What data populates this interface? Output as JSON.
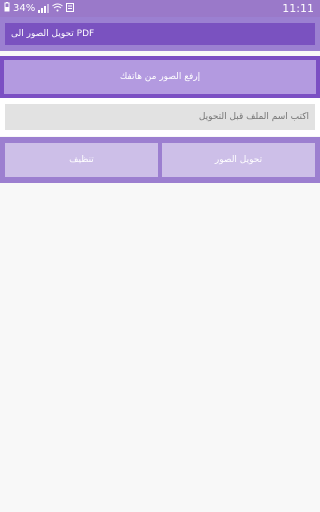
{
  "status_bar": {
    "battery": "34%",
    "time": "11:11"
  },
  "app_bar": {
    "title": "تحويل الصور الى PDF"
  },
  "upload": {
    "label": "إرفع الصور من هاتفك"
  },
  "file_name": {
    "placeholder": "أكتب اسم الملف قبل التحويل",
    "value": ""
  },
  "actions": {
    "convert_label": "تحويل الصور",
    "clear_label": "تنظيف"
  },
  "colors": {
    "status_bar": "#9a79c9",
    "app_bar": "#9b80d1",
    "title_bg": "#7a52c0",
    "upload_frame": "#7b4fc3",
    "upload_button": "#b39ae0",
    "action_frame": "#9c7fd0",
    "action_button": "#cdbfe8"
  }
}
